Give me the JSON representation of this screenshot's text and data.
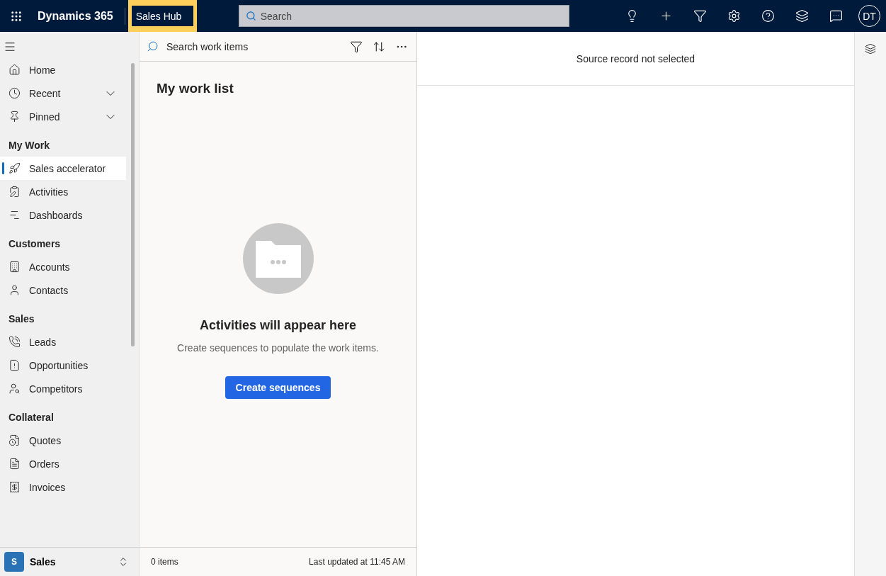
{
  "top_bar": {
    "app_name": "Dynamics 365",
    "area": "Sales Hub",
    "search": {
      "placeholder": "Search"
    },
    "avatar": "DT"
  },
  "sidebar": {
    "items": [
      {
        "kind": "item",
        "label": "Home",
        "selected": false
      },
      {
        "kind": "expandable",
        "label": "Recent",
        "selected": false,
        "expanded": false
      },
      {
        "kind": "expandable",
        "label": "Pinned",
        "selected": false,
        "expanded": false
      },
      {
        "kind": "heading",
        "label": "My Work"
      },
      {
        "kind": "item",
        "label": "Sales accelerator",
        "selected": true
      },
      {
        "kind": "item",
        "label": "Activities",
        "selected": false
      },
      {
        "kind": "item",
        "label": "Dashboards",
        "selected": false
      },
      {
        "kind": "heading",
        "label": "Customers"
      },
      {
        "kind": "item",
        "label": "Accounts",
        "selected": false
      },
      {
        "kind": "item",
        "label": "Contacts",
        "selected": false
      },
      {
        "kind": "heading",
        "label": "Sales"
      },
      {
        "kind": "item",
        "label": "Leads",
        "selected": false
      },
      {
        "kind": "item",
        "label": "Opportunities",
        "selected": false
      },
      {
        "kind": "item",
        "label": "Competitors",
        "selected": false
      },
      {
        "kind": "heading",
        "label": "Collateral"
      },
      {
        "kind": "item",
        "label": "Quotes",
        "selected": false
      },
      {
        "kind": "item",
        "label": "Orders",
        "selected": false
      },
      {
        "kind": "item",
        "label": "Invoices",
        "selected": false
      }
    ],
    "area_switcher": {
      "badge": "S",
      "label": "Sales"
    }
  },
  "work_list": {
    "search": {
      "placeholder": "Search work items"
    },
    "title": "My work list",
    "empty_title": "Activities will appear here",
    "empty_text": "Create sequences to populate the work items.",
    "button": "Create sequences",
    "count": "0 items",
    "updated": "Last updated at 11:45 AM"
  },
  "record_pane": {
    "message": "Source record not selected"
  }
}
